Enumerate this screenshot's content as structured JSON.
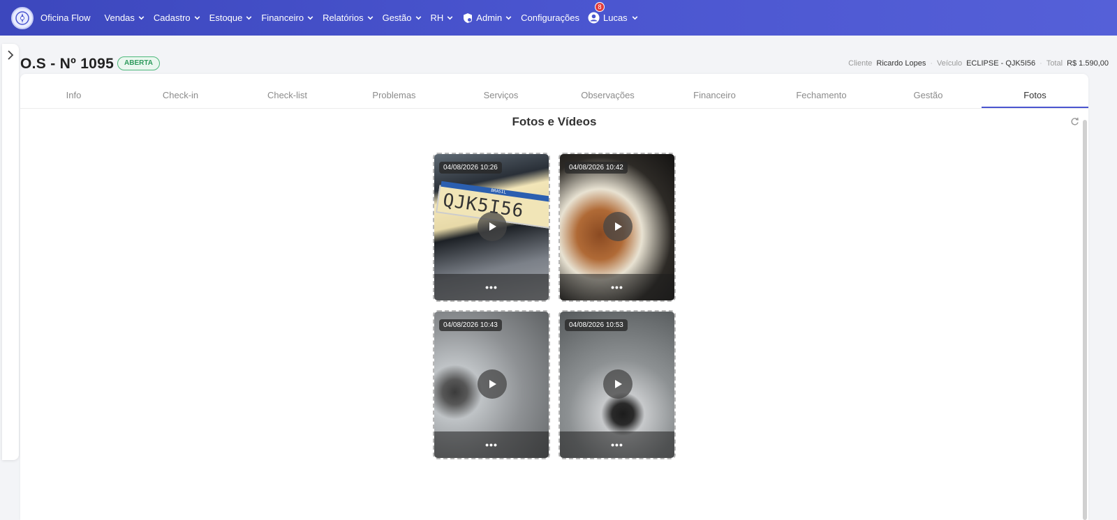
{
  "app": {
    "name": "Oficina Flow",
    "accent_color": "#4a55cf",
    "status_color": "#2e9a5c"
  },
  "nav": {
    "items": [
      {
        "label": "Vendas",
        "has_dropdown": true
      },
      {
        "label": "Cadastro",
        "has_dropdown": true
      },
      {
        "label": "Estoque",
        "has_dropdown": true
      },
      {
        "label": "Financeiro",
        "has_dropdown": true
      },
      {
        "label": "Relatórios",
        "has_dropdown": true
      },
      {
        "label": "Gestão",
        "has_dropdown": true
      },
      {
        "label": "RH",
        "has_dropdown": true
      },
      {
        "label": "Admin",
        "has_dropdown": true,
        "icon": "shield-gear-icon"
      },
      {
        "label": "Configurações",
        "has_dropdown": false
      }
    ],
    "user": {
      "name": "Lucas",
      "notification_count": "8",
      "icon": "user-circle-icon"
    }
  },
  "order": {
    "title": "O.S - Nº 1095",
    "status": "ABERTA",
    "client_label": "Cliente",
    "client_value": "Ricardo Lopes",
    "vehicle_label": "Veículo",
    "vehicle_value": "ECLIPSE - QJK5I56",
    "total_label": "Total",
    "total_value": "R$ 1.590,00"
  },
  "tabs": [
    {
      "label": "Info",
      "active": false
    },
    {
      "label": "Check-in",
      "active": false
    },
    {
      "label": "Check-list",
      "active": false
    },
    {
      "label": "Problemas",
      "active": false
    },
    {
      "label": "Serviços",
      "active": false
    },
    {
      "label": "Observações",
      "active": false
    },
    {
      "label": "Financeiro",
      "active": false
    },
    {
      "label": "Fechamento",
      "active": false
    },
    {
      "label": "Gestão",
      "active": false
    },
    {
      "label": "Fotos",
      "active": true
    }
  ],
  "media_section": {
    "title": "Fotos e Vídeos",
    "items": [
      {
        "timestamp": "04/08/2026 10:26",
        "type": "video",
        "menu": "•••",
        "plate_text": "QJK5I56",
        "plate_country": "BRASIL"
      },
      {
        "timestamp": "04/08/2026 10:42",
        "type": "video",
        "menu": "•••"
      },
      {
        "timestamp": "04/08/2026 10:43",
        "type": "video",
        "menu": "•••"
      },
      {
        "timestamp": "04/08/2026 10:53",
        "type": "video",
        "menu": "•••"
      }
    ]
  }
}
